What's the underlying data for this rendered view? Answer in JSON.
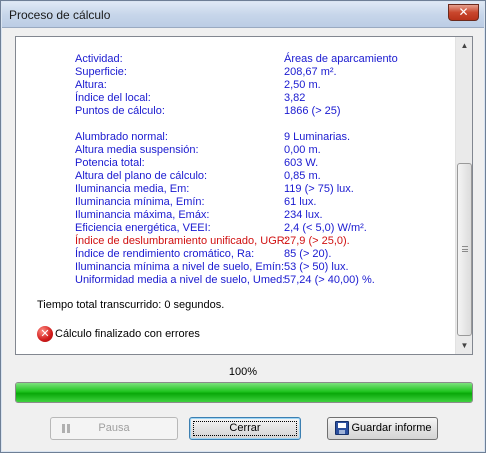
{
  "window": {
    "title": "Proceso de cálculo",
    "close_label": "✕"
  },
  "report": {
    "group1": [
      {
        "label": "Actividad:",
        "value": "Áreas de aparcamiento"
      },
      {
        "label": "Superficie:",
        "value": "208,67 m²."
      },
      {
        "label": "Altura:",
        "value": "2,50 m."
      },
      {
        "label": "Índice del local:",
        "value": "3,82"
      },
      {
        "label": "Puntos de cálculo:",
        "value": "1866 (> 25)"
      }
    ],
    "group2": [
      {
        "label": "Alumbrado normal:",
        "value": "9 Luminarias."
      },
      {
        "label": "Altura media suspensión:",
        "value": "0,00 m."
      },
      {
        "label": "Potencia total:",
        "value": "603 W."
      },
      {
        "label": "Altura del plano de cálculo:",
        "value": "0,85 m."
      },
      {
        "label": "Iluminancia media, Em:",
        "value": "119 (> 75) lux."
      },
      {
        "label": "Iluminancia mínima, Emín:",
        "value": "61 lux."
      },
      {
        "label": "Iluminancia máxima, Emáx:",
        "value": "234 lux."
      },
      {
        "label": "Eficiencia energética, VEEI:",
        "value": "2,4 (< 5,0) W/m²."
      },
      {
        "label": "Índice de deslumbramiento unificado, UGR:",
        "value": "27,9 (> 25,0).",
        "error": true
      },
      {
        "label": "Índice de rendimiento cromático, Ra:",
        "value": "85 (> 20)."
      },
      {
        "label": "Iluminancia mínima a nivel de suelo, Emín:",
        "value": "53 (> 50) lux."
      },
      {
        "label": "Uniformidad media a nivel de suelo, Umed:",
        "value": "57,24 (> 40,00) %."
      }
    ],
    "total_time": "Tiempo total transcurrido: 0 segundos.",
    "error_message": "Cálculo finalizado con errores"
  },
  "progress": {
    "label": "100%",
    "value": 1.0
  },
  "buttons": {
    "pause": "Pausa",
    "close": "Cerrar",
    "save_report": "Guardar informe"
  },
  "colors": {
    "text_blue": "#1a1ad0",
    "text_error": "#d01010",
    "progress_green": "#09a809"
  },
  "icons": {
    "error": "error-x-circle-icon",
    "pause": "pause-icon",
    "save": "floppy-disk-icon"
  }
}
